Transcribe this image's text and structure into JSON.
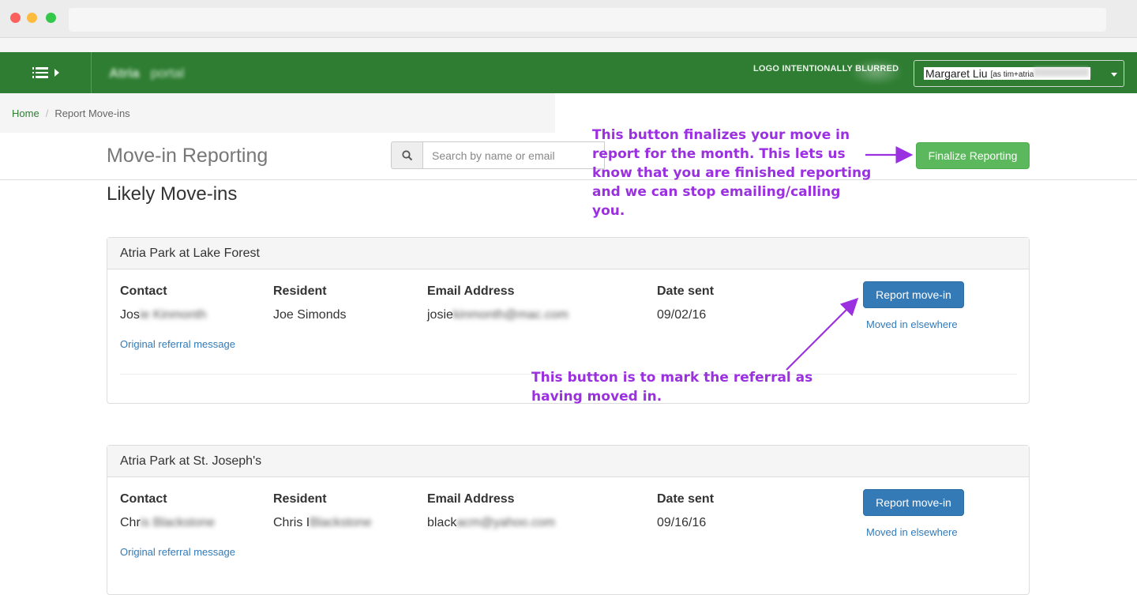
{
  "topnav": {
    "brand": "Atria",
    "brand_sub": "portal",
    "logo_note": "LOGO INTENTIONALLY BLURRED",
    "user_name": "Margaret Liu",
    "user_as": "[as tim+atria",
    "user_as_blurred": "@caring.com]"
  },
  "breadcrumb": {
    "home": "Home",
    "separator": "/",
    "current": "Report Move-ins"
  },
  "header": {
    "title": "Move-in Reporting",
    "search_placeholder": "Search by name or email",
    "finalize_label": "Finalize Reporting"
  },
  "section_title": "Likely Move-ins",
  "columns": {
    "contact": "Contact",
    "resident": "Resident",
    "email": "Email Address",
    "date_sent": "Date sent"
  },
  "panels": [
    {
      "community": "Atria Park at Lake Forest",
      "contact_visible": "Jos",
      "contact_blurred": "ie Kinmonth",
      "resident": "Joe Simonds",
      "resident_blurred": "",
      "email_visible": "josie",
      "email_blurred": "kinmonth@mac.com",
      "date_sent": "09/02/16",
      "referral_link": "Original referral message",
      "report_label": "Report move-in",
      "moved_elsewhere": "Moved in elsewhere"
    },
    {
      "community": "Atria Park at St. Joseph's",
      "contact_visible": "Chr",
      "contact_blurred": "is Blackstone",
      "resident": "Chris I",
      "resident_blurred": "Blackstone",
      "email_visible": "black",
      "email_blurred": "acm@yahoo.com",
      "date_sent": "09/16/16",
      "referral_link": "Original referral message",
      "report_label": "Report move-in",
      "moved_elsewhere": "Moved in elsewhere"
    }
  ],
  "annotations": {
    "finalize_note": [
      "This button finalizes your move in",
      "report for the month. This lets us",
      "know that you are finished reporting",
      "and we can stop emailing/calling",
      "you."
    ],
    "report_note": [
      "This button is to mark the referral as",
      "having moved in."
    ],
    "color": "#9b30e0"
  },
  "colors": {
    "nav_green": "#2e7d32",
    "finalize_green": "#5cb85c",
    "primary_blue": "#337ab7"
  }
}
